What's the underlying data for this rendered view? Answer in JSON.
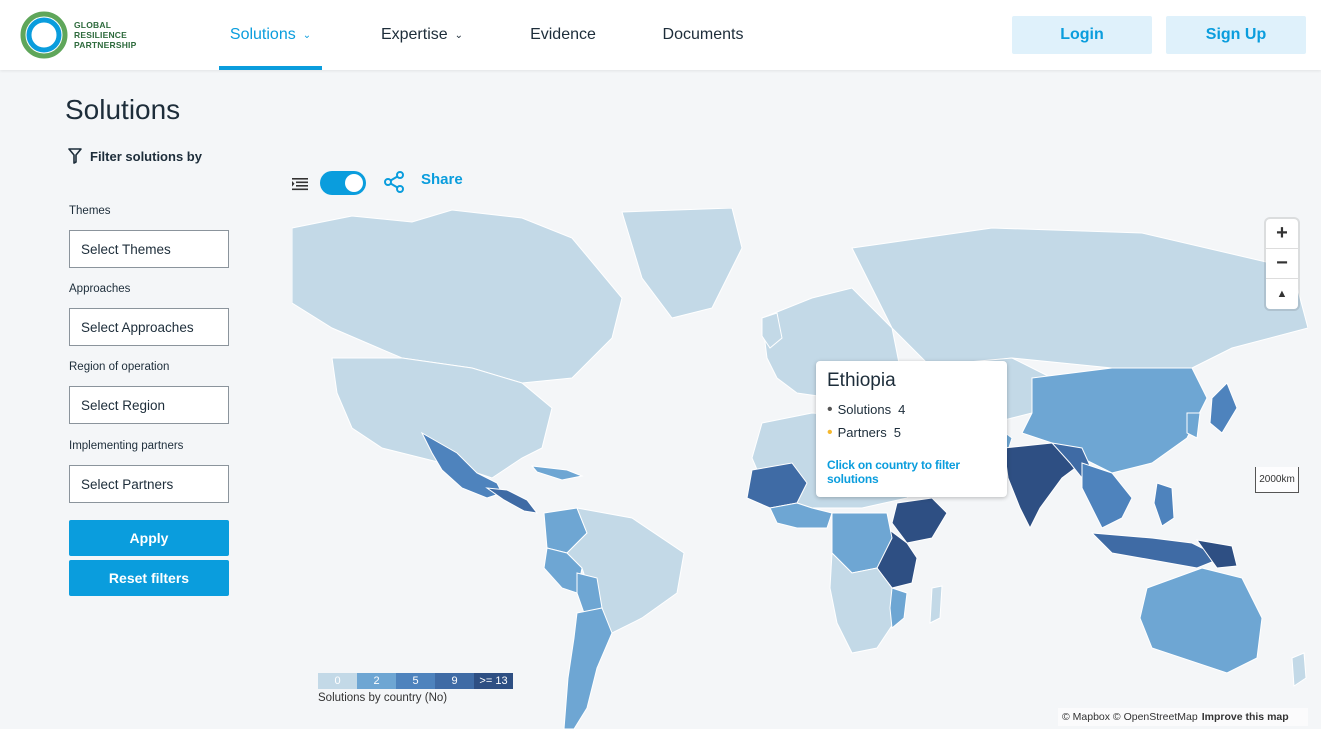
{
  "brand": {
    "logo_line1": "GLOBAL",
    "logo_line2": "RESILIENCE",
    "logo_line3": "PARTNERSHIP",
    "primary_color": "#0a9ddd",
    "logo_green": "#2d6a3c"
  },
  "nav": {
    "solutions": "Solutions",
    "expertise": "Expertise",
    "evidence": "Evidence",
    "documents": "Documents",
    "chevron_icon": "chevron-down-icon"
  },
  "auth": {
    "login": "Login",
    "signup": "Sign Up"
  },
  "page": {
    "title": "Solutions"
  },
  "filters": {
    "heading": "Filter solutions by",
    "themes_label": "Themes",
    "themes_value": "Select Themes",
    "approaches_label": "Approaches",
    "approaches_value": "Select Approaches",
    "region_label": "Region of operation",
    "region_value": "Select Region",
    "partners_label": "Implementing partners",
    "partners_value": "Select Partners",
    "apply": "Apply",
    "reset": "Reset filters"
  },
  "toolbar": {
    "share": "Share",
    "map_toggle_on": true
  },
  "map": {
    "zoom_in": "+",
    "zoom_out": "−",
    "compass": "▲",
    "scale": "2000km",
    "attribution_1": "© Mapbox © OpenStreetMap",
    "attribution_2": "Improve this map",
    "country_colors": [
      "#c3d9e7",
      "#6ea6d3",
      "#4e83bd",
      "#3f6ba5",
      "#2e4f83"
    ]
  },
  "tooltip": {
    "country": "Ethiopia",
    "solutions_label": "Solutions",
    "solutions_value": "4",
    "partners_label": "Partners",
    "partners_value": "5",
    "link": "Click on country to filter solutions",
    "solutions_dot_color": "#555555",
    "partners_dot_color": "#f5b82e"
  },
  "legend": {
    "items": [
      {
        "label": "0",
        "color": "#c3d9e7"
      },
      {
        "label": "2",
        "color": "#6ea6d3"
      },
      {
        "label": "5",
        "color": "#4e83bd"
      },
      {
        "label": "9",
        "color": "#3f6ba5"
      },
      {
        "label": ">= 13",
        "color": "#2e4f83"
      }
    ],
    "caption": "Solutions by country (No)"
  }
}
